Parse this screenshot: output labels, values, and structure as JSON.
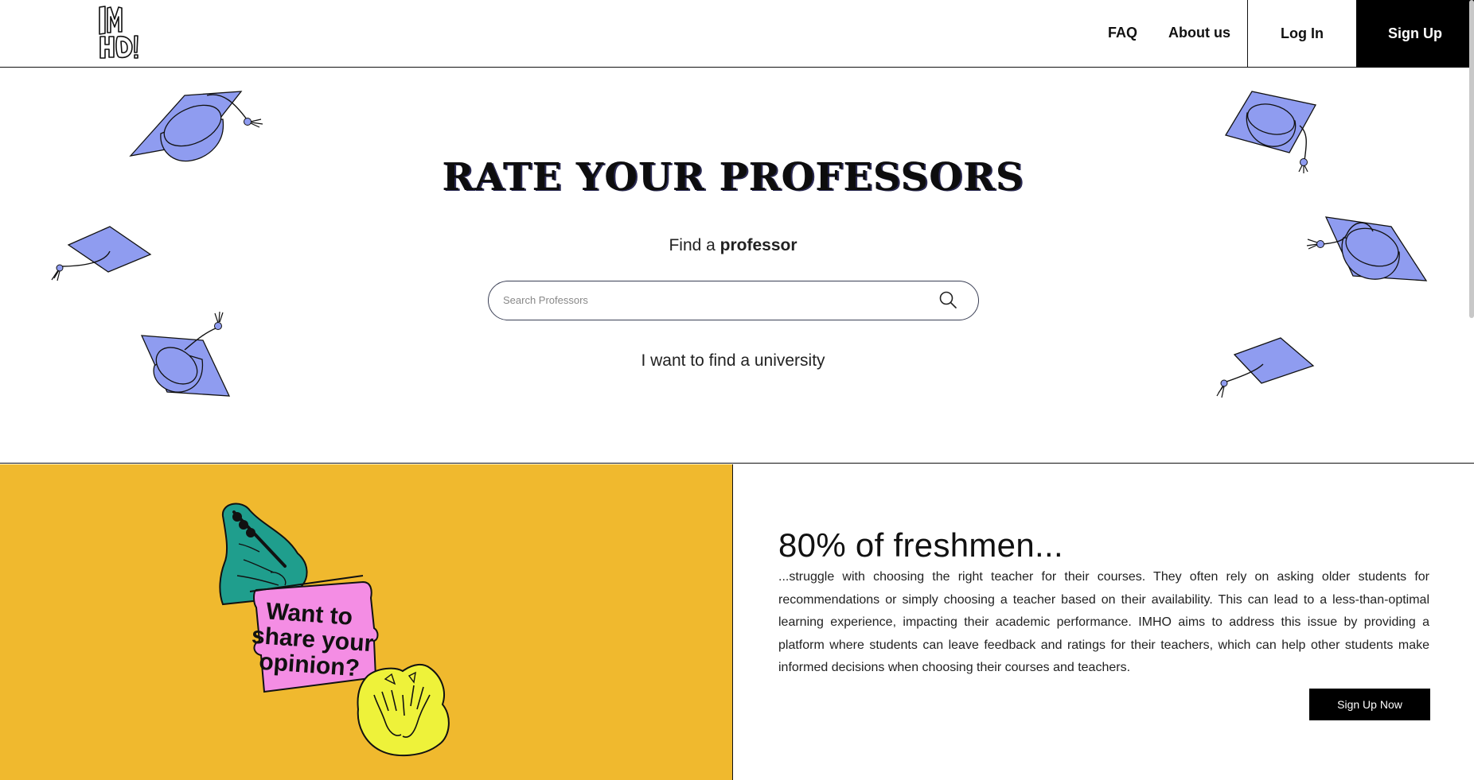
{
  "brand": {
    "logo_text": "IMHO!"
  },
  "nav": {
    "faq": "FAQ",
    "about": "About us",
    "login": "Log In",
    "signup": "Sign Up"
  },
  "hero": {
    "title": "RATE YOUR PROFESSORS",
    "find_prefix": "Find a",
    "find_bold": "professor",
    "search_placeholder": "Search Professors",
    "university_link": "I want to find a university"
  },
  "promo": {
    "sticker_text": "Want to share your opinion?"
  },
  "info": {
    "heading": "80% of freshmen...",
    "body": "...struggle with choosing the right teacher for their courses. They often rely on asking older students for recommendations or simply choosing a teacher based on their availability. This can lead to a less-than-optimal learning experience, impacting their academic performance. IMHO aims to address this issue by providing a platform where students can leave feedback and ratings for their teachers, which can help other students make informed decisions when choosing their courses and teachers.",
    "cta": "Sign Up Now"
  },
  "colors": {
    "accent_cap": "#8f9cf0",
    "yellow": "#f0b92e",
    "pink": "#f48de4",
    "teal": "#1f9e8d",
    "lime": "#eef23a"
  }
}
